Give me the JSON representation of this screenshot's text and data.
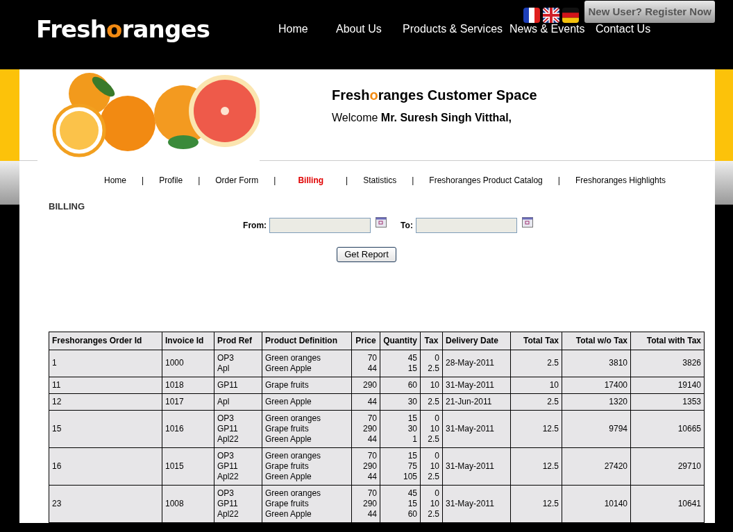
{
  "header": {
    "logo": [
      "Fresh",
      "o",
      "ranges"
    ],
    "flags": [
      {
        "kind": "france"
      },
      {
        "kind": "uk"
      },
      {
        "kind": "germany"
      }
    ],
    "register_button": "New User? Register Now",
    "nav": [
      "Home",
      "About Us",
      "Products & Services",
      "News & Events",
      "Contact Us"
    ]
  },
  "banner": {
    "title": [
      "Fresh",
      "o",
      "ranges Customer Space"
    ],
    "welcome": "Welcome",
    "user": "Mr. Suresh Singh Vitthal,"
  },
  "subnav": {
    "separator": "|",
    "items": [
      {
        "label": "Home",
        "selected": false
      },
      {
        "label": "Profile",
        "selected": false
      },
      {
        "label": "Order Form",
        "selected": false
      },
      {
        "label": "Billing",
        "selected": true
      },
      {
        "label": "Statistics",
        "selected": false
      },
      {
        "label": "Freshoranges Product Catalog",
        "selected": false
      },
      {
        "label": "Freshoranges Highlights",
        "selected": false
      }
    ]
  },
  "billing": {
    "heading": "BILLING",
    "from_label": "From:",
    "to_label": "To:",
    "button": "Get Report"
  },
  "table": {
    "columns": [
      "Freshoranges Order Id",
      "Invoice Id",
      "Prod Ref",
      "Product Definition",
      "Price",
      "Quantity",
      "Tax",
      "Delivery Date",
      "Total Tax",
      "Total w/o Tax",
      "Total with Tax"
    ],
    "rows": [
      {
        "order_id": "1",
        "invoice_id": "1000",
        "prod_ref": [
          "OP3",
          "Apl"
        ],
        "product_definition": [
          "Green oranges",
          "Green Apple"
        ],
        "price": [
          "70",
          "44"
        ],
        "quantity": [
          "45",
          "15"
        ],
        "tax": [
          "0",
          "2.5"
        ],
        "delivery_date": "28-May-2011",
        "total_tax": "2.5",
        "total_wo_tax": "3810",
        "total_with_tax": "3826"
      },
      {
        "order_id": "11",
        "invoice_id": "1018",
        "prod_ref": [
          "GP11"
        ],
        "product_definition": [
          "Grape fruits"
        ],
        "price": [
          "290"
        ],
        "quantity": [
          "60"
        ],
        "tax": [
          "10"
        ],
        "delivery_date": "31-May-2011",
        "total_tax": "10",
        "total_wo_tax": "17400",
        "total_with_tax": "19140"
      },
      {
        "order_id": "12",
        "invoice_id": "1017",
        "prod_ref": [
          "Apl"
        ],
        "product_definition": [
          "Green Apple"
        ],
        "price": [
          "44"
        ],
        "quantity": [
          "30"
        ],
        "tax": [
          "2.5"
        ],
        "delivery_date": "21-Jun-2011",
        "total_tax": "2.5",
        "total_wo_tax": "1320",
        "total_with_tax": "1353"
      },
      {
        "order_id": "15",
        "invoice_id": "1016",
        "prod_ref": [
          "OP3",
          "GP11",
          "Apl22"
        ],
        "product_definition": [
          "Green oranges",
          "Grape fruits",
          "Green Apple"
        ],
        "price": [
          "70",
          "290",
          "44"
        ],
        "quantity": [
          "15",
          "30",
          "1"
        ],
        "tax": [
          "0",
          "10",
          "2.5"
        ],
        "delivery_date": "31-May-2011",
        "total_tax": "12.5",
        "total_wo_tax": "9794",
        "total_with_tax": "10665"
      },
      {
        "order_id": "16",
        "invoice_id": "1015",
        "prod_ref": [
          "OP3",
          "GP11",
          "Apl22"
        ],
        "product_definition": [
          "Green oranges",
          "Grape fruits",
          "Green Apple"
        ],
        "price": [
          "70",
          "290",
          "44"
        ],
        "quantity": [
          "15",
          "75",
          "105"
        ],
        "tax": [
          "0",
          "10",
          "2.5"
        ],
        "delivery_date": "31-May-2011",
        "total_tax": "12.5",
        "total_wo_tax": "27420",
        "total_with_tax": "29710"
      },
      {
        "order_id": "23",
        "invoice_id": "1008",
        "prod_ref": [
          "OP3",
          "GP11",
          "Apl22"
        ],
        "product_definition": [
          "Green oranges",
          "Grape fruits",
          "Green Apple"
        ],
        "price": [
          "70",
          "290",
          "44"
        ],
        "quantity": [
          "45",
          "15",
          "60"
        ],
        "tax": [
          "0",
          "10",
          "2.5"
        ],
        "delivery_date": "31-May-2011",
        "total_tax": "12.5",
        "total_wo_tax": "10140",
        "total_with_tax": "10641"
      }
    ]
  }
}
